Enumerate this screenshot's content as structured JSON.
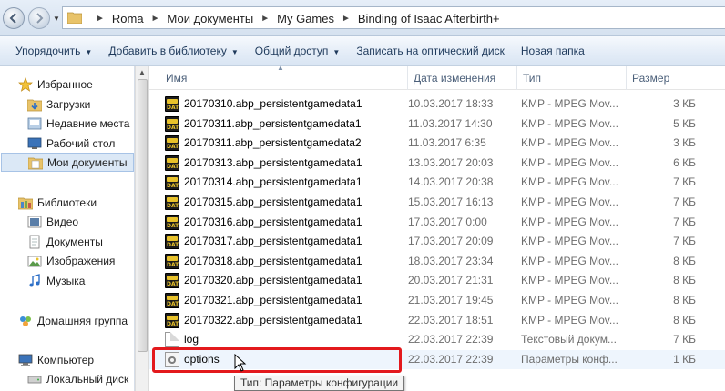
{
  "address": {
    "breadcrumbs": [
      "Roma",
      "Мои документы",
      "My Games",
      "Binding of Isaac Afterbirth+"
    ]
  },
  "toolbar": {
    "organize": "Упорядочить",
    "add_library": "Добавить в библиотеку",
    "share": "Общий доступ",
    "burn": "Записать на оптический диск",
    "new_folder": "Новая папка"
  },
  "sidebar": {
    "favorites": "Избранное",
    "downloads": "Загрузки",
    "recent": "Недавние места",
    "desktop": "Рабочий стол",
    "mydocs": "Мои документы",
    "libraries": "Библиотеки",
    "video": "Видео",
    "documents": "Документы",
    "images": "Изображения",
    "music": "Музыка",
    "homegroup": "Домашняя группа",
    "computer": "Компьютер",
    "localdisk": "Локальный диск"
  },
  "columns": {
    "name": "Имя",
    "date": "Дата изменения",
    "type": "Тип",
    "size": "Размер"
  },
  "files": [
    {
      "name": "20170310.abp_persistentgamedata1",
      "date": "10.03.2017 18:33",
      "type": "KMP - MPEG Mov...",
      "size": "3 КБ",
      "icon": "dat-icon"
    },
    {
      "name": "20170311.abp_persistentgamedata1",
      "date": "11.03.2017 14:30",
      "type": "KMP - MPEG Mov...",
      "size": "5 КБ",
      "icon": "dat-icon"
    },
    {
      "name": "20170311.abp_persistentgamedata2",
      "date": "11.03.2017 6:35",
      "type": "KMP - MPEG Mov...",
      "size": "3 КБ",
      "icon": "dat-icon"
    },
    {
      "name": "20170313.abp_persistentgamedata1",
      "date": "13.03.2017 20:03",
      "type": "KMP - MPEG Mov...",
      "size": "6 КБ",
      "icon": "dat-icon"
    },
    {
      "name": "20170314.abp_persistentgamedata1",
      "date": "14.03.2017 20:38",
      "type": "KMP - MPEG Mov...",
      "size": "7 КБ",
      "icon": "dat-icon"
    },
    {
      "name": "20170315.abp_persistentgamedata1",
      "date": "15.03.2017 16:13",
      "type": "KMP - MPEG Mov...",
      "size": "7 КБ",
      "icon": "dat-icon"
    },
    {
      "name": "20170316.abp_persistentgamedata1",
      "date": "17.03.2017 0:00",
      "type": "KMP - MPEG Mov...",
      "size": "7 КБ",
      "icon": "dat-icon"
    },
    {
      "name": "20170317.abp_persistentgamedata1",
      "date": "17.03.2017 20:09",
      "type": "KMP - MPEG Mov...",
      "size": "7 КБ",
      "icon": "dat-icon"
    },
    {
      "name": "20170318.abp_persistentgamedata1",
      "date": "18.03.2017 23:34",
      "type": "KMP - MPEG Mov...",
      "size": "8 КБ",
      "icon": "dat-icon"
    },
    {
      "name": "20170320.abp_persistentgamedata1",
      "date": "20.03.2017 21:31",
      "type": "KMP - MPEG Mov...",
      "size": "8 КБ",
      "icon": "dat-icon"
    },
    {
      "name": "20170321.abp_persistentgamedata1",
      "date": "21.03.2017 19:45",
      "type": "KMP - MPEG Mov...",
      "size": "8 КБ",
      "icon": "dat-icon"
    },
    {
      "name": "20170322.abp_persistentgamedata1",
      "date": "22.03.2017 18:51",
      "type": "KMP - MPEG Mov...",
      "size": "8 КБ",
      "icon": "dat-icon"
    },
    {
      "name": "log",
      "date": "22.03.2017 22:39",
      "type": "Текстовый докум...",
      "size": "7 КБ",
      "icon": "text-document-icon"
    },
    {
      "name": "options",
      "date": "22.03.2017 22:39",
      "type": "Параметры конф...",
      "size": "1 КБ",
      "icon": "config-file-icon"
    }
  ],
  "tooltip": "Тип: Параметры конфигурации",
  "colors": {
    "highlight": "#e3191d",
    "dat_icon_accent": "#e8c22b"
  }
}
